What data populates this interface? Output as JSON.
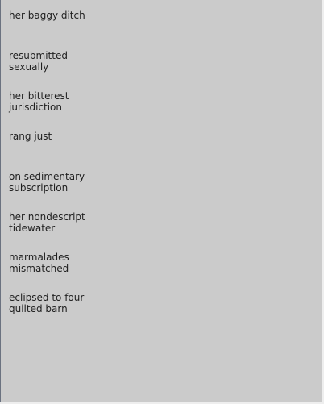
{
  "list": {
    "items": [
      {
        "label": "her baggy ditch"
      },
      {
        "label": "resubmitted\nsexually"
      },
      {
        "label": "her bitterest\njurisdiction"
      },
      {
        "label": "rang just"
      },
      {
        "label": "on sedimentary\nsubscription"
      },
      {
        "label": "her nondescript\ntidewater"
      },
      {
        "label": "marmalades\nmismatched"
      },
      {
        "label": "eclipsed to four\nquilted barn"
      }
    ]
  },
  "colors": {
    "panel_background": "#cbcbcb",
    "text": "#1f1f1f"
  }
}
